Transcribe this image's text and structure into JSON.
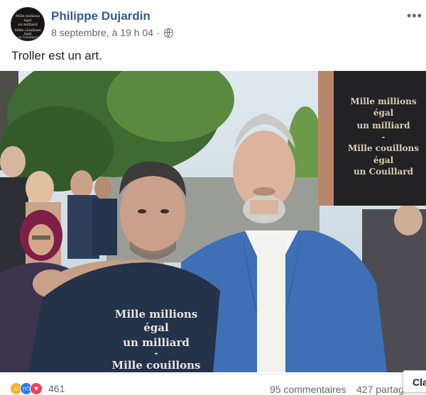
{
  "post": {
    "author": "Philippe Dujardin",
    "timestamp": "8 septembre, à 19 h 04 ·",
    "privacy_icon": "globe-icon",
    "caption": "Troller est un art."
  },
  "avatar": {
    "lines": [
      "Mille millions",
      "égal",
      "un milliard",
      "-",
      "Mille couillons",
      "égal",
      "un Couillard"
    ]
  },
  "photo": {
    "shirt_lines": [
      "Mille millions",
      "égal",
      "un milliard",
      "-",
      "Mille couillons"
    ],
    "inset_lines": [
      "Mille millions",
      "égal",
      "un milliard",
      "-",
      "Mille couillons",
      "égal",
      "un Couillard"
    ]
  },
  "footer": {
    "reaction_icons": [
      "haha-icon",
      "like-icon",
      "love-icon"
    ],
    "reaction_count": "461",
    "comments": "95 commentaires",
    "shares": "427 partages"
  },
  "overlay": {
    "button_label": "Cla"
  }
}
